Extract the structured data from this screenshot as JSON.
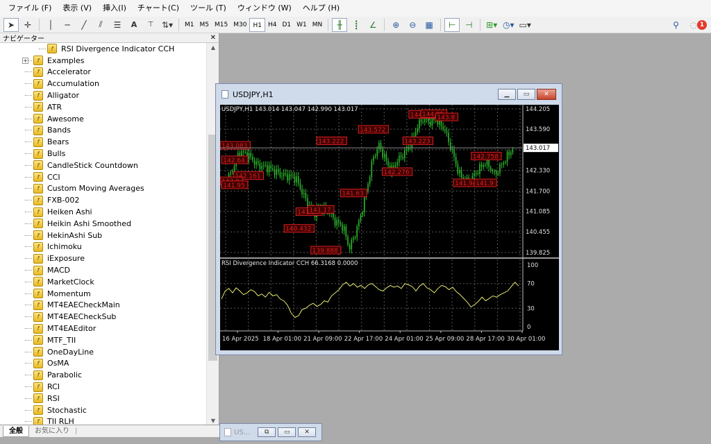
{
  "menu": [
    "ファイル (F)",
    "表示 (V)",
    "挿入(I)",
    "チャート(C)",
    "ツール (T)",
    "ウィンドウ (W)",
    "ヘルプ (H)"
  ],
  "toolbar": {
    "timeframes": [
      "M1",
      "M5",
      "M15",
      "M30",
      "H1",
      "H4",
      "D1",
      "W1",
      "MN"
    ],
    "active_timeframe": "H1",
    "notification_count": "1"
  },
  "navigator": {
    "title": "ナビゲーター",
    "top_item": "RSI Divergence Indicator CCH",
    "items": [
      "Examples",
      "Accelerator",
      "Accumulation",
      "Alligator",
      "ATR",
      "Awesome",
      "Bands",
      "Bears",
      "Bulls",
      "CandleStick Countdown",
      "CCI",
      "Custom Moving Averages",
      "FXB-002",
      "Heiken Ashi",
      "Heikin Ashi Smoothed",
      "HekinAshi Sub",
      "Ichimoku",
      "iExposure",
      "MACD",
      "MarketClock",
      "Momentum",
      "MT4EAECheckMain",
      "MT4EAECheckSub",
      "MT4EAEditor",
      "MTF_TII",
      "OneDayLine",
      "OsMA",
      "Parabolic",
      "RCI",
      "RSI",
      "Stochastic",
      "TII RLH"
    ],
    "tabs": [
      "全般",
      "お気に入り"
    ]
  },
  "chart_window": {
    "title": "USDJPY,H1",
    "mini_title": "US...",
    "colors": {
      "bull": "#2db82d",
      "bear": "#e02020",
      "rsi": "#e8e870",
      "label_border": "#e02020"
    }
  },
  "chart_data": [
    {
      "type": "candlestick",
      "header": "USDJPY,H1  143.014 143.047 142.990 143.017",
      "y_ticks": [
        "144.205",
        "143.590",
        "142.960",
        "142.330",
        "141.700",
        "141.085",
        "140.455",
        "139.825"
      ],
      "ylim": [
        139.825,
        144.205
      ],
      "current_price": "143.017",
      "close_path": [
        [
          0,
          141.9
        ],
        [
          3,
          142.2
        ],
        [
          6,
          142.9
        ],
        [
          9,
          142.8
        ],
        [
          12,
          142.5
        ],
        [
          16,
          142.4
        ],
        [
          20,
          142.2
        ],
        [
          25,
          142.1
        ],
        [
          28,
          141.5
        ],
        [
          31,
          141.0
        ],
        [
          33,
          141.2
        ],
        [
          36,
          141.1
        ],
        [
          38,
          140.8
        ],
        [
          41,
          140.6
        ],
        [
          43,
          139.95
        ],
        [
          45,
          140.4
        ],
        [
          47,
          141.0
        ],
        [
          49,
          141.8
        ],
        [
          51,
          142.7
        ],
        [
          53,
          143.1
        ],
        [
          55,
          142.7
        ],
        [
          57,
          142.3
        ],
        [
          59,
          142.6
        ],
        [
          62,
          142.9
        ],
        [
          64,
          143.2
        ],
        [
          66,
          143.7
        ],
        [
          68,
          143.9
        ],
        [
          70,
          143.8
        ],
        [
          72,
          143.9
        ],
        [
          75,
          143.6
        ],
        [
          78,
          142.8
        ],
        [
          80,
          142.2
        ],
        [
          83,
          141.95
        ],
        [
          86,
          142.3
        ],
        [
          89,
          142.6
        ],
        [
          92,
          142.2
        ],
        [
          95,
          142.6
        ],
        [
          98,
          143.0
        ]
      ],
      "labels": [
        {
          "text": "143.083",
          "x": 0.5,
          "y": 143.083
        },
        {
          "text": "142.64",
          "x": 1,
          "y": 142.64
        },
        {
          "text": "142.161",
          "x": 5,
          "y": 142.161
        },
        {
          "text": "142.0",
          "x": 0.5,
          "y": 142.0
        },
        {
          "text": "141.95",
          "x": 1,
          "y": 141.88
        },
        {
          "text": "143.222",
          "x": 33,
          "y": 143.222
        },
        {
          "text": "143.572",
          "x": 47,
          "y": 143.572
        },
        {
          "text": "141.63",
          "x": 41,
          "y": 141.63
        },
        {
          "text": "141.17",
          "x": 26,
          "y": 141.06
        },
        {
          "text": "141.17",
          "x": 30,
          "y": 141.13
        },
        {
          "text": "140.432",
          "x": 22,
          "y": 140.55
        },
        {
          "text": "139.888",
          "x": 31,
          "y": 139.888
        },
        {
          "text": "142.276",
          "x": 55,
          "y": 142.28
        },
        {
          "text": "143.223",
          "x": 62,
          "y": 143.223
        },
        {
          "text": "144.03",
          "x": 64,
          "y": 144.03
        },
        {
          "text": "144.05",
          "x": 68,
          "y": 144.05
        },
        {
          "text": "143.8",
          "x": 73,
          "y": 143.95
        },
        {
          "text": "142.758",
          "x": 85,
          "y": 142.758
        },
        {
          "text": "141.94",
          "x": 79,
          "y": 141.94
        },
        {
          "text": "141.9",
          "x": 86,
          "y": 141.94
        }
      ]
    },
    {
      "type": "line",
      "header": "RSI Divergence Indicator CCH 66.3168 0.0000",
      "y_ticks": [
        "100",
        "70",
        "30",
        "0"
      ],
      "ylim": [
        0,
        100
      ],
      "x_ticks": [
        "16 Apr 2025",
        "18 Apr 01:00",
        "21 Apr 09:00",
        "22 Apr 17:00",
        "24 Apr 01:00",
        "25 Apr 09:00",
        "28 Apr 17:00",
        "30 Apr 01:00"
      ],
      "series": [
        {
          "values": [
            45,
            58,
            62,
            55,
            63,
            58,
            52,
            55,
            60,
            57,
            50,
            53,
            48,
            56,
            50,
            52,
            45,
            42,
            35,
            22,
            15,
            18,
            28,
            30,
            35,
            38,
            33,
            36,
            42,
            40,
            50,
            55,
            60,
            68,
            72,
            66,
            70,
            64,
            67,
            62,
            68,
            70,
            65,
            60,
            58,
            63,
            67,
            64,
            66,
            62,
            70,
            68,
            65,
            58,
            66,
            70,
            63,
            60,
            55,
            62,
            67,
            65,
            60,
            64,
            57,
            52,
            46,
            40,
            32,
            36,
            41,
            48,
            42,
            46,
            50,
            48,
            52,
            55,
            58,
            65,
            72,
            66
          ]
        }
      ]
    }
  ]
}
